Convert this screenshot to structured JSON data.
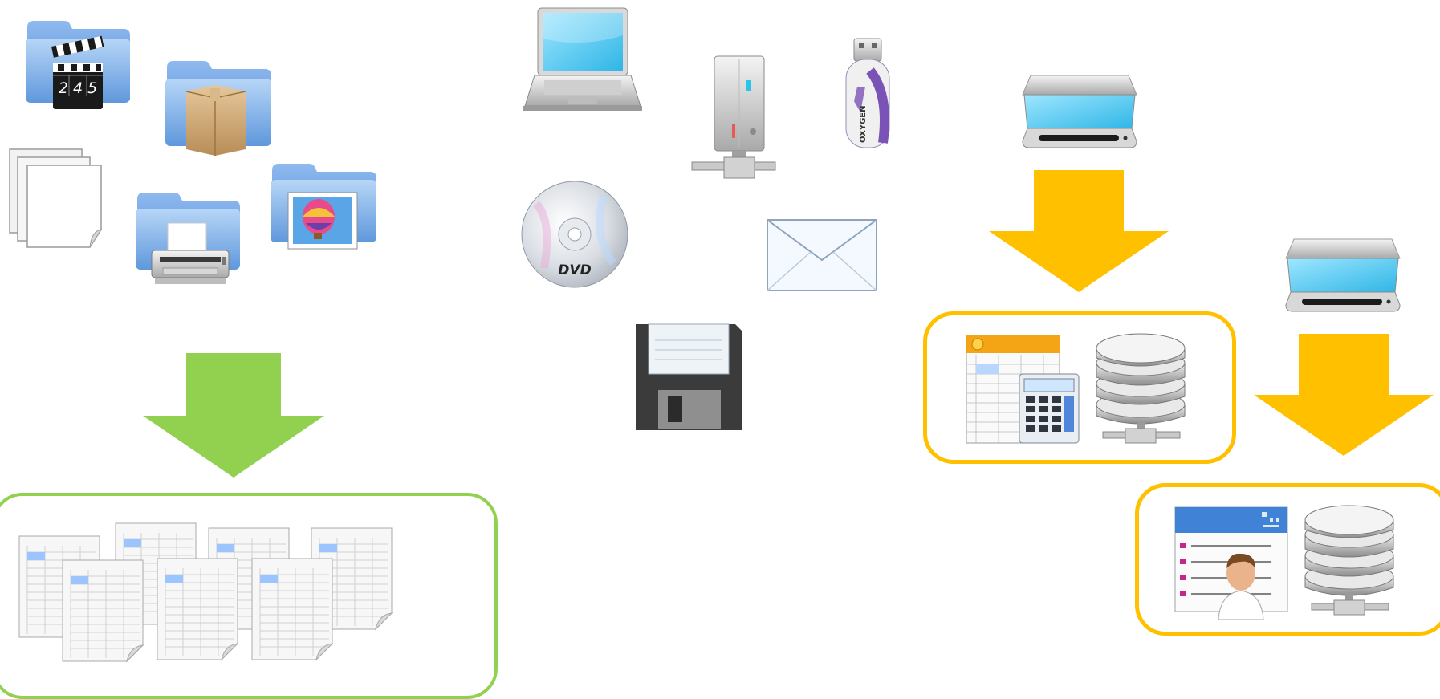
{
  "colors": {
    "green_accent": "#92d050",
    "yellow_accent": "#ffc000",
    "folder_blue": "#7fb2e8",
    "background": "#ffffff"
  },
  "sources_group": {
    "icons": [
      {
        "name": "video-folder-icon",
        "clapper_digits": "2 4 5"
      },
      {
        "name": "package-folder-icon"
      },
      {
        "name": "documents-stack-icon"
      },
      {
        "name": "printer-folder-icon"
      },
      {
        "name": "pictures-folder-icon"
      }
    ],
    "arrow": "down-arrow-icon",
    "result_icon": "spreadsheet-files-icon"
  },
  "devices_group": {
    "icons": [
      {
        "name": "laptop-icon"
      },
      {
        "name": "network-server-icon"
      },
      {
        "name": "usb-drive-icon",
        "brand": "OXYGEN"
      },
      {
        "name": "dvd-disc-icon",
        "label": "DVD"
      },
      {
        "name": "email-envelope-icon"
      },
      {
        "name": "floppy-disk-icon"
      }
    ]
  },
  "scan_groups": [
    {
      "scanner": "scanner-icon",
      "arrow": "down-arrow-icon",
      "results": [
        "spreadsheet-calculator-icon",
        "database-server-icon"
      ]
    },
    {
      "scanner": "scanner-icon",
      "arrow": "down-arrow-icon",
      "results": [
        "contact-card-icon",
        "database-server-icon"
      ]
    }
  ]
}
